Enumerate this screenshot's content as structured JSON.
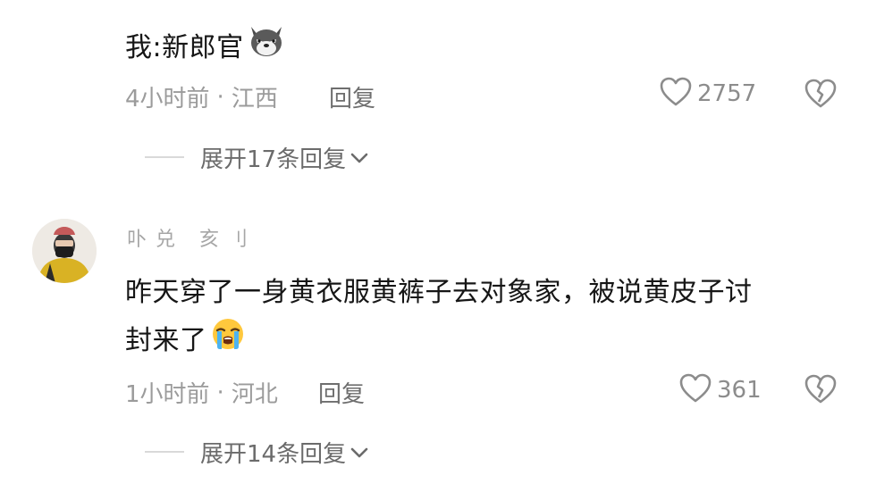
{
  "comment1": {
    "text": "我:新郎官",
    "emoji": "wolf-emoji",
    "time": "4小时前",
    "sep": "·",
    "location": "江西",
    "reply_label": "回复",
    "likes": "2757",
    "expand_label": "展开17条回复"
  },
  "comment2": {
    "username": "卟兑 亥刂",
    "text_line1": "昨天穿了一身黄衣服黄裤子去对象家，被说黄皮子讨",
    "text_line2": "封来了",
    "emoji": "crying-emoji",
    "time": "1小时前",
    "sep": "·",
    "location": "河北",
    "reply_label": "回复",
    "likes": "361",
    "expand_label": "展开14条回复"
  },
  "colors": {
    "meta": "#9b9b9b",
    "divider": "#d9d9d9",
    "icon": "#8c8c8c"
  }
}
